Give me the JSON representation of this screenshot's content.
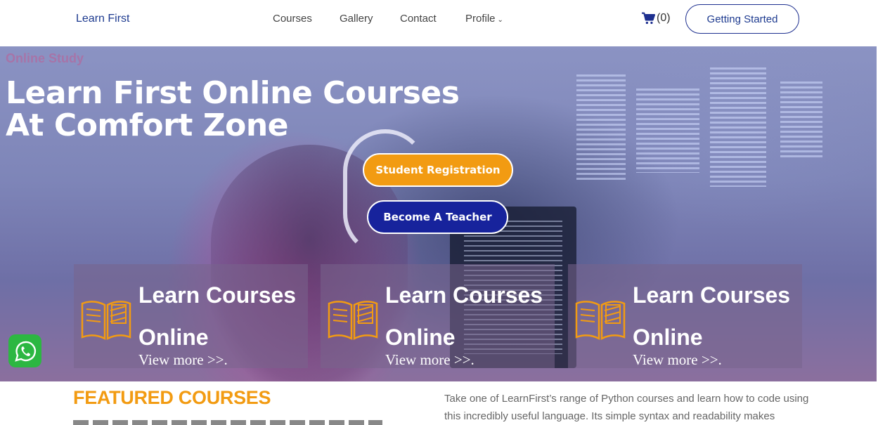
{
  "header": {
    "brand": "Learn First",
    "nav": [
      "Courses",
      "Gallery",
      "Contact",
      "Profile"
    ],
    "cart_count": "(0)",
    "cta_label": "Getting Started"
  },
  "hero": {
    "eyebrow": "Online Study",
    "headline_line1": "Learn First Online Courses",
    "headline_line2": "At Comfort Zone",
    "primary_button": "Student Registration",
    "secondary_button": "Become A Teacher",
    "cards": [
      {
        "title_line1": "Learn Courses",
        "title_line2": "Online",
        "link": "View more >>."
      },
      {
        "title_line1": "Learn Courses",
        "title_line2": "Online",
        "link": "View more >>."
      },
      {
        "title_line1": "Learn Courses",
        "title_line2": "Online",
        "link": "View more >>."
      }
    ]
  },
  "featured": {
    "heading": "FEATURED COURSES",
    "description": "Take one of LearnFirst’s range of Python courses and learn how to code using this incredibly useful language. Its simple syntax and readability makes"
  },
  "colors": {
    "accent_orange": "#f29b12",
    "brand_blue": "#17239c",
    "whatsapp_green": "#2cb742"
  },
  "icons": {
    "cart": "shopping-cart-icon",
    "chevron": "chevron-down-icon",
    "book": "open-book-icon",
    "whatsapp": "whatsapp-icon"
  }
}
